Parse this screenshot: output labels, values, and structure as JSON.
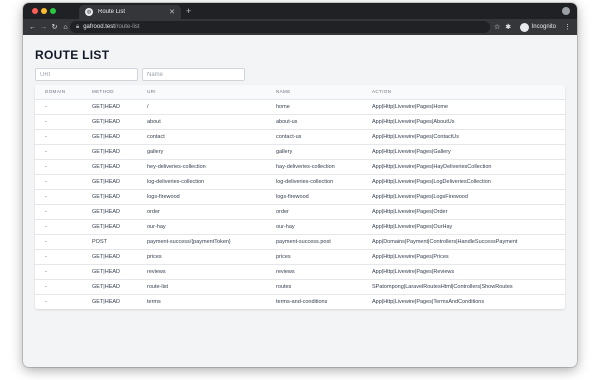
{
  "browser": {
    "tab_title": "Route List",
    "url_host": "gafrood.test",
    "url_path": "/route-list",
    "incognito_label": "Incognito",
    "icons": {
      "back": "arrow-left-icon",
      "forward": "arrow-right-icon",
      "reload": "reload-icon",
      "home": "home-icon",
      "lock": "lock-icon",
      "star": "star-icon",
      "extensions": "puzzle-icon",
      "menu": "kebab-menu-icon"
    }
  },
  "page": {
    "title": "ROUTE LIST",
    "filters": {
      "uri_placeholder": "URI",
      "name_placeholder": "Name"
    }
  },
  "table": {
    "headers": [
      "DOMAIN",
      "METHOD",
      "URI",
      "NAME",
      "ACTION"
    ],
    "rows": [
      [
        "-",
        "GET|HEAD",
        "/",
        "home",
        "App|Http|Livewire|Pages|Home"
      ],
      [
        "-",
        "GET|HEAD",
        "about",
        "about-us",
        "App|Http|Livewire|Pages|AboutUs"
      ],
      [
        "-",
        "GET|HEAD",
        "contact",
        "contact-us",
        "App|Http|Livewire|Pages|ContactUs"
      ],
      [
        "-",
        "GET|HEAD",
        "gallery",
        "gallery",
        "App|Http|Livewire|Pages|Gallery"
      ],
      [
        "-",
        "GET|HEAD",
        "hey-deliveries-collection",
        "hay-deliveries-collection",
        "App|Http|Livewire|Pages|HayDeliveriesCollection"
      ],
      [
        "-",
        "GET|HEAD",
        "log-deliveries-collection",
        "log-deliveries-collection",
        "App|Http|Livewire|Pages|LogDeliveriesCollection"
      ],
      [
        "-",
        "GET|HEAD",
        "logs-firewood",
        "logs-firewood",
        "App|Http|Livewire|Pages|LogsFirewood"
      ],
      [
        "-",
        "GET|HEAD",
        "order",
        "order",
        "App|Http|Livewire|Pages|Order"
      ],
      [
        "-",
        "GET|HEAD",
        "our-hay",
        "our-hay",
        "App|Http|Livewire|Pages|OurHay"
      ],
      [
        "-",
        "POST",
        "payment-success/{paymentToken}",
        "payment-success.post",
        "App|Domains|Payment|Controllers|HandleSuccessPayment"
      ],
      [
        "-",
        "GET|HEAD",
        "prices",
        "prices",
        "App|Http|Livewire|Pages|Prices"
      ],
      [
        "-",
        "GET|HEAD",
        "reviews",
        "reviews",
        "App|Http|Livewire|Pages|Reviews"
      ],
      [
        "-",
        "GET|HEAD",
        "route-list",
        "routes",
        "SPatompong|LaravelRoutesHtml|Controllers|ShowRoutes"
      ],
      [
        "-",
        "GET|HEAD",
        "terms",
        "terms-and-conditions",
        "App|Http|Livewire|Pages|TermsAndConditions"
      ]
    ]
  }
}
